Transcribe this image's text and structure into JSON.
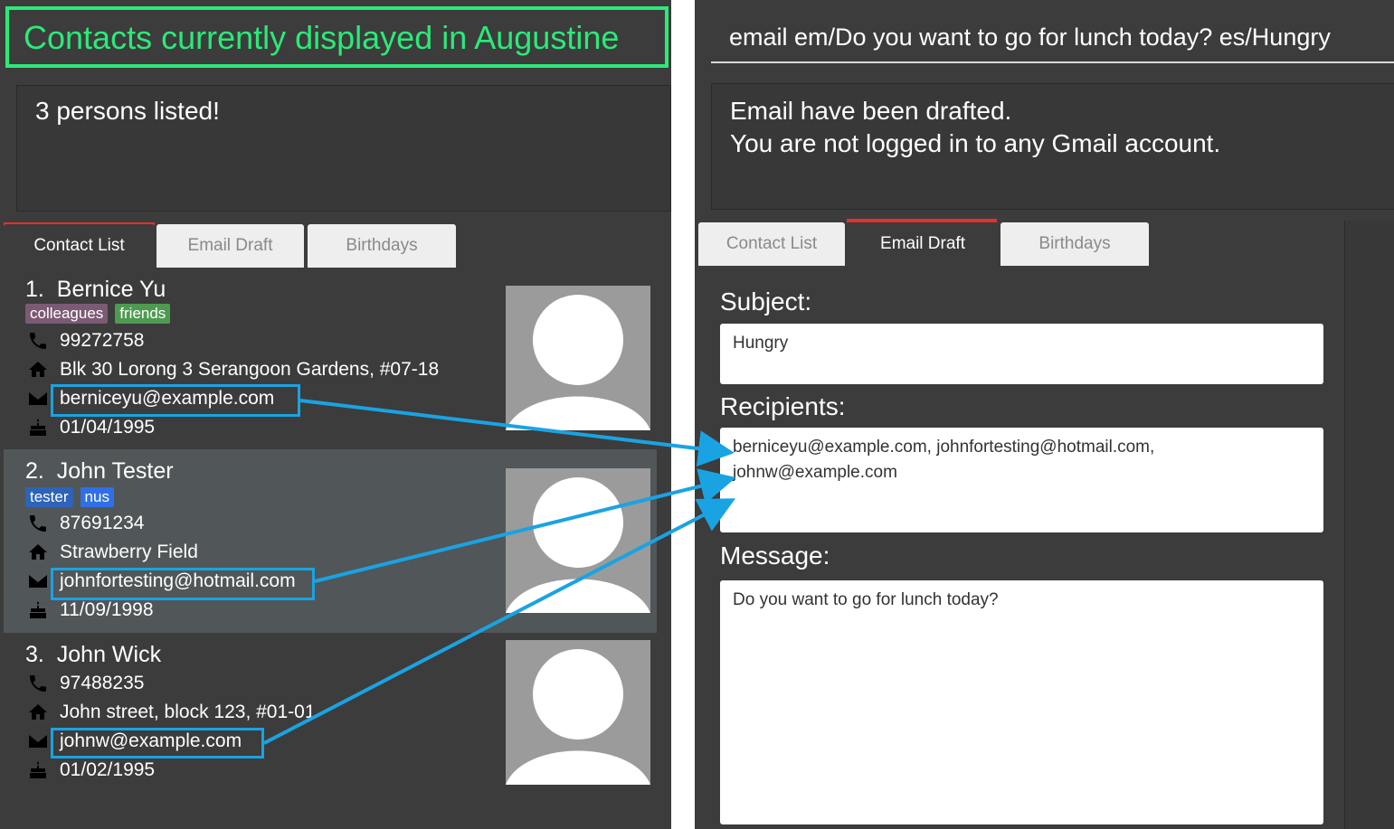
{
  "caption": "Contacts currently displayed in Augustine",
  "left": {
    "result_text": "3 persons listed!",
    "tabs": [
      {
        "label": "Contact List",
        "active": true
      },
      {
        "label": "Email Draft",
        "active": false
      },
      {
        "label": "Birthdays",
        "active": false
      }
    ],
    "contacts": [
      {
        "index": "1.",
        "name": "Bernice Yu",
        "tags": [
          {
            "label": "colleagues",
            "color": "#7b5a74"
          },
          {
            "label": "friends",
            "color": "#4e9a51"
          }
        ],
        "phone": "99272758",
        "address": "Blk 30 Lorong 3 Serangoon Gardens, #07-18",
        "email": "berniceyu@example.com",
        "birthday": "01/04/1995"
      },
      {
        "index": "2.",
        "name": "John Tester",
        "tags": [
          {
            "label": "tester",
            "color": "#2d63b8"
          },
          {
            "label": "nus",
            "color": "#2f70e8"
          }
        ],
        "phone": "87691234",
        "address": "Strawberry Field",
        "email": "johnfortesting@hotmail.com",
        "birthday": "11/09/1998"
      },
      {
        "index": "3.",
        "name": "John Wick",
        "tags": [],
        "phone": "97488235",
        "address": "John street, block 123, #01-01",
        "email": "johnw@example.com",
        "birthday": "01/02/1995"
      }
    ]
  },
  "right": {
    "command": "email em/Do you want to go for lunch today? es/Hungry",
    "result_line1": "Email have been drafted.",
    "result_line2": "You are not logged in to any Gmail account.",
    "tabs": [
      {
        "label": "Contact List",
        "active": false
      },
      {
        "label": "Email Draft",
        "active": true
      },
      {
        "label": "Birthdays",
        "active": false
      }
    ],
    "subject_label": "Subject:",
    "subject_value": "Hungry",
    "recipients_label": "Recipients:",
    "recipients_line1": "berniceyu@example.com, johnfortesting@hotmail.com,",
    "recipients_line2": "johnw@example.com",
    "message_label": "Message:",
    "message_value": "Do you want to go for lunch today?"
  },
  "colors": {
    "highlight": "#1aa3e3",
    "caption_green": "#2bea78",
    "tab_indicator": "#e0322e"
  },
  "icons": [
    "phone-icon",
    "home-icon",
    "email-icon",
    "cake-icon",
    "avatar-placeholder-icon"
  ]
}
